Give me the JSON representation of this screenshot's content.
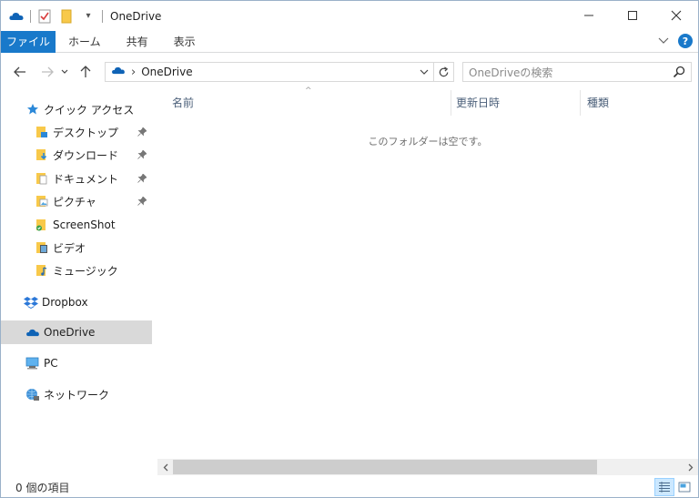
{
  "window": {
    "title": "OneDrive",
    "minimize_glyph": "─",
    "maximize_glyph": "☐",
    "close_glyph": "✕"
  },
  "quick_access_toolbar": {
    "icons": [
      "onedrive-icon",
      "properties-checklist-icon",
      "new-folder-icon",
      "customize-dropdown-icon"
    ],
    "dropdown_glyph": "▾"
  },
  "ribbon": {
    "file_label": "ファイル",
    "tabs": [
      "ホーム",
      "共有",
      "表示"
    ],
    "expand_glyph": "∨",
    "help_glyph": "?"
  },
  "address_bar": {
    "back_glyph": "←",
    "forward_glyph": "→",
    "recent_glyph": "⌄",
    "up_glyph": "↑",
    "separator_glyph": "›",
    "path": "OneDrive",
    "dropdown_glyph": "⌄",
    "refresh_glyph": "↻"
  },
  "search": {
    "placeholder": "OneDriveの検索"
  },
  "nav_pane": {
    "quick_access": "クイック アクセス",
    "items": [
      {
        "label": "デスクトップ",
        "pinned": true
      },
      {
        "label": "ダウンロード",
        "pinned": true
      },
      {
        "label": "ドキュメント",
        "pinned": true
      },
      {
        "label": "ピクチャ",
        "pinned": true
      },
      {
        "label": "ScreenShot",
        "pinned": false
      },
      {
        "label": "ビデオ",
        "pinned": false
      },
      {
        "label": "ミュージック",
        "pinned": false
      }
    ],
    "dropbox": "Dropbox",
    "onedrive": "OneDrive",
    "pc": "PC",
    "network": "ネットワーク"
  },
  "content": {
    "columns": [
      "名前",
      "更新日時",
      "種類"
    ],
    "sort_glyph": "^",
    "empty_message": "このフォルダーは空です。"
  },
  "scrollbar": {
    "left_glyph": "<",
    "right_glyph": ">"
  },
  "status_bar": {
    "item_count": "0 個の項目"
  },
  "colors": {
    "accent": "#1979ca",
    "selected_nav": "#d9d9d9",
    "onedrive_blue": "#0f63b6",
    "folder_yellow": "#f8c94a"
  }
}
